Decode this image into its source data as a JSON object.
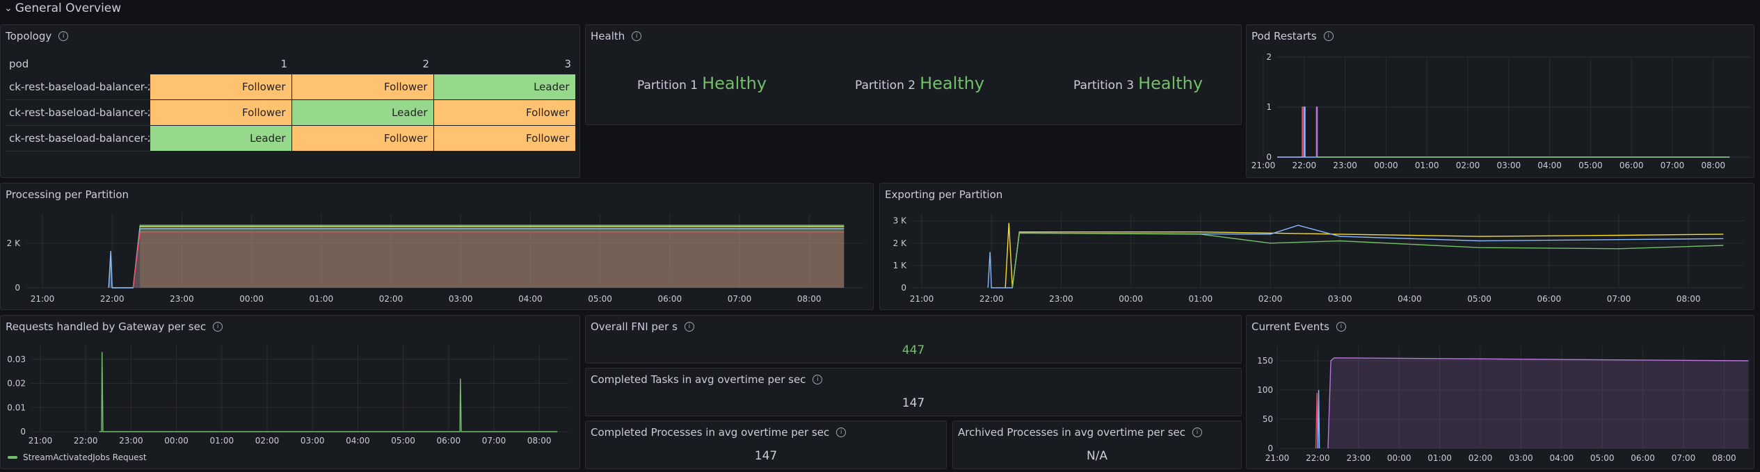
{
  "row": {
    "title": "General Overview"
  },
  "topology": {
    "title": "Topology",
    "headers": [
      "pod",
      "1",
      "2",
      "3"
    ],
    "rows": [
      {
        "pod": "ck-rest-baseload-balancer-ze",
        "roles": [
          "Follower",
          "Follower",
          "Leader"
        ]
      },
      {
        "pod": "ck-rest-baseload-balancer-ze",
        "roles": [
          "Follower",
          "Leader",
          "Follower"
        ]
      },
      {
        "pod": "ck-rest-baseload-balancer-ze",
        "roles": [
          "Leader",
          "Follower",
          "Follower"
        ]
      }
    ]
  },
  "health": {
    "title": "Health",
    "items": [
      {
        "label": "Partition 1",
        "value": "Healthy"
      },
      {
        "label": "Partition 2",
        "value": "Healthy"
      },
      {
        "label": "Partition 3",
        "value": "Healthy"
      }
    ]
  },
  "pod_restarts": {
    "title": "Pod Restarts"
  },
  "processing": {
    "title": "Processing per Partition"
  },
  "exporting": {
    "title": "Exporting per Partition"
  },
  "requests": {
    "title": "Requests handled by Gateway per sec",
    "legend": "StreamActivatedJobs Request"
  },
  "fni": {
    "title": "Overall FNI per s",
    "value": "447"
  },
  "completed_tasks": {
    "title": "Completed Tasks in avg overtime per sec",
    "value": "147"
  },
  "completed_processes": {
    "title": "Completed Processes in avg overtime per sec",
    "value": "147"
  },
  "archived_processes": {
    "title": "Archived Processes in avg overtime per sec",
    "value": "N/A"
  },
  "current_events": {
    "title": "Current Events"
  },
  "colors": {
    "follower": "#ffc271",
    "leader": "#96d98d",
    "green": "#73bf69",
    "yellow": "#fade2a",
    "blue": "#8ab8ff",
    "purple": "#b877d9",
    "red": "#f2495c"
  },
  "chart_data": [
    {
      "id": "pod_restarts",
      "type": "line",
      "x_ticks": [
        "21:00",
        "22:00",
        "23:00",
        "00:00",
        "01:00",
        "02:00",
        "03:00",
        "04:00",
        "05:00",
        "06:00",
        "07:00",
        "08:00"
      ],
      "y_ticks": [
        "0",
        "1",
        "2"
      ],
      "ylim": [
        0,
        2
      ],
      "grid": true,
      "series": [
        {
          "color": "#f2495c",
          "points": [
            [
              -0.1,
              0
            ],
            [
              0.95,
              0
            ],
            [
              0.95,
              1
            ],
            [
              0.97,
              1
            ],
            [
              0.97,
              0
            ]
          ]
        },
        {
          "color": "#8ab8ff",
          "points": [
            [
              -0.1,
              0
            ],
            [
              1.0,
              0
            ],
            [
              1.0,
              1
            ],
            [
              1.02,
              1
            ],
            [
              1.02,
              0
            ],
            [
              11.4,
              0
            ]
          ]
        },
        {
          "color": "#b877d9",
          "points": [
            [
              1.3,
              0
            ],
            [
              1.3,
              1
            ],
            [
              1.32,
              1
            ],
            [
              1.32,
              0
            ],
            [
              11.4,
              0
            ]
          ]
        },
        {
          "color": "#73bf69",
          "points": [
            [
              1.3,
              0
            ],
            [
              11.4,
              0
            ]
          ]
        }
      ]
    },
    {
      "id": "processing",
      "type": "area",
      "x_ticks": [
        "21:00",
        "22:00",
        "23:00",
        "00:00",
        "01:00",
        "02:00",
        "03:00",
        "04:00",
        "05:00",
        "06:00",
        "07:00",
        "08:00"
      ],
      "y_ticks": [
        "0",
        "2 K"
      ],
      "y_values": [
        0,
        2000
      ],
      "ylim": [
        0,
        3300
      ],
      "grid": true,
      "series": [
        {
          "color": "#73bf69",
          "points": [
            [
              -0.3,
              null
            ],
            [
              0.95,
              0
            ],
            [
              0.98,
              1500
            ],
            [
              1.0,
              0
            ],
            [
              1.3,
              0
            ],
            [
              1.4,
              2800
            ],
            [
              11.5,
              2800
            ]
          ]
        },
        {
          "color": "#fade2a",
          "points": [
            [
              1.4,
              2750
            ],
            [
              11.5,
              2750
            ]
          ]
        },
        {
          "color": "#8ab8ff",
          "points": [
            [
              0.95,
              0
            ],
            [
              0.98,
              1650
            ],
            [
              1.0,
              0
            ],
            [
              1.3,
              0
            ],
            [
              1.4,
              2650
            ],
            [
              11.5,
              2650
            ]
          ]
        },
        {
          "color": "#f2495c",
          "points": [
            [
              1.3,
              0
            ],
            [
              1.4,
              2500
            ],
            [
              11.5,
              2500
            ]
          ]
        }
      ]
    },
    {
      "id": "exporting",
      "type": "line",
      "x_ticks": [
        "21:00",
        "22:00",
        "23:00",
        "00:00",
        "01:00",
        "02:00",
        "03:00",
        "04:00",
        "05:00",
        "06:00",
        "07:00",
        "08:00"
      ],
      "y_ticks": [
        "0",
        "1 K",
        "2 K",
        "3 K"
      ],
      "y_values": [
        0,
        1000,
        2000,
        3000
      ],
      "ylim": [
        0,
        3300
      ],
      "grid": true,
      "series": [
        {
          "color": "#fade2a",
          "points": [
            [
              1.2,
              0
            ],
            [
              1.25,
              2900
            ],
            [
              1.3,
              0
            ],
            [
              1.4,
              2500
            ],
            [
              4,
              2500
            ],
            [
              6,
              2400
            ],
            [
              8,
              2300
            ],
            [
              10,
              2350
            ],
            [
              11.5,
              2400
            ]
          ]
        },
        {
          "color": "#8ab8ff",
          "points": [
            [
              0.95,
              0
            ],
            [
              0.98,
              1600
            ],
            [
              1.0,
              0
            ],
            [
              1.3,
              0
            ],
            [
              1.4,
              2450
            ],
            [
              5,
              2400
            ],
            [
              5.4,
              2800
            ],
            [
              6,
              2300
            ],
            [
              8,
              2100
            ],
            [
              11.5,
              2200
            ]
          ]
        },
        {
          "color": "#73bf69",
          "points": [
            [
              1.3,
              0
            ],
            [
              1.4,
              2450
            ],
            [
              4,
              2400
            ],
            [
              5,
              2000
            ],
            [
              6,
              2100
            ],
            [
              8,
              1800
            ],
            [
              10,
              1750
            ],
            [
              11.5,
              1900
            ]
          ]
        }
      ]
    },
    {
      "id": "requests",
      "type": "line",
      "x_ticks": [
        "21:00",
        "22:00",
        "23:00",
        "00:00",
        "01:00",
        "02:00",
        "03:00",
        "04:00",
        "05:00",
        "06:00",
        "07:00",
        "08:00"
      ],
      "y_ticks": [
        "0",
        "0.01",
        "0.02",
        "0.03"
      ],
      "y_values": [
        0,
        0.01,
        0.02,
        0.03
      ],
      "ylim": [
        0,
        0.036
      ],
      "grid": true,
      "series": [
        {
          "name": "StreamActivatedJobs Request",
          "color": "#73bf69",
          "points": [
            [
              1.3,
              0
            ],
            [
              1.35,
              0
            ],
            [
              1.36,
              0.033
            ],
            [
              1.38,
              0
            ],
            [
              9.25,
              0
            ],
            [
              9.26,
              0.022
            ],
            [
              9.28,
              0
            ],
            [
              11.4,
              0
            ]
          ]
        }
      ]
    },
    {
      "id": "current_events",
      "type": "area",
      "x_ticks": [
        "21:00",
        "22:00",
        "23:00",
        "00:00",
        "01:00",
        "02:00",
        "03:00",
        "04:00",
        "05:00",
        "06:00",
        "07:00",
        "08:00"
      ],
      "y_ticks": [
        "0",
        "50",
        "100",
        "150"
      ],
      "y_values": [
        0,
        50,
        100,
        150
      ],
      "ylim": [
        0,
        175
      ],
      "grid": true,
      "series": [
        {
          "color": "#f2495c",
          "points": [
            [
              0.95,
              0
            ],
            [
              0.98,
              95
            ],
            [
              1.0,
              0
            ]
          ]
        },
        {
          "color": "#8ab8ff",
          "points": [
            [
              1.0,
              0
            ],
            [
              1.02,
              100
            ],
            [
              1.04,
              0
            ]
          ]
        },
        {
          "color": "#b877d9",
          "points": [
            [
              1.25,
              0
            ],
            [
              1.32,
              150
            ],
            [
              1.4,
              155
            ],
            [
              11.6,
              150
            ]
          ]
        }
      ]
    }
  ]
}
